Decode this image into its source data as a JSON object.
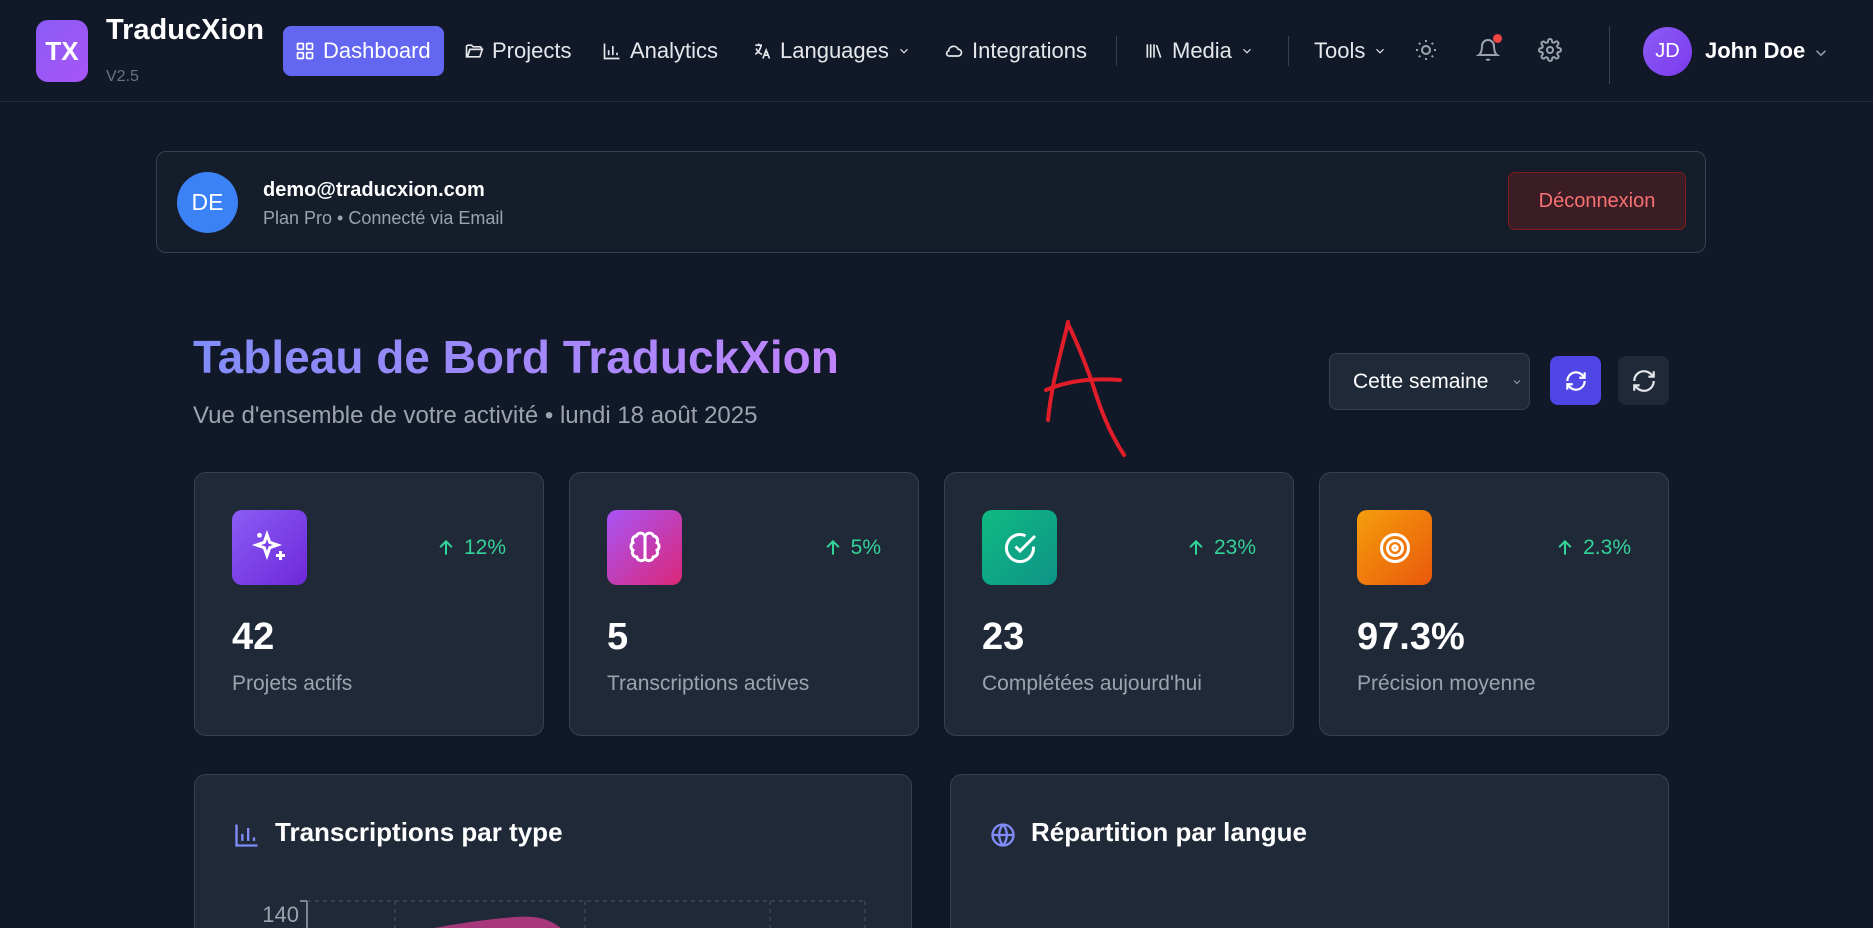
{
  "app": {
    "logo_text": "TX",
    "name": "TraducXion",
    "version": "V2.5"
  },
  "nav": {
    "dashboard": "Dashboard",
    "projects": "Projects",
    "analytics": "Analytics",
    "languages": "Languages",
    "integrations": "Integrations",
    "media": "Media",
    "tools": "Tools",
    "active_color": "#6366f1"
  },
  "user": {
    "initials": "JD",
    "name": "John Doe"
  },
  "account": {
    "initials": "DE",
    "email": "demo@traducxion.com",
    "plan": "Plan Pro • Connecté via Email",
    "logout": "Déconnexion"
  },
  "header": {
    "title": "Tableau de Bord TraduckXion",
    "subtitle": "Vue d'ensemble de votre activité • lundi 18 août 2025",
    "annotation": "A",
    "period": "Cette semaine"
  },
  "stats": [
    {
      "icon": "sparkles-icon",
      "color": "#8b5cf6",
      "trend": "12%",
      "value": "42",
      "label": "Projets actifs"
    },
    {
      "icon": "brain-icon",
      "color": "#c026d3",
      "trend": "5%",
      "value": "5",
      "label": "Transcriptions actives"
    },
    {
      "icon": "check-circle-icon",
      "color": "#10b981",
      "trend": "23%",
      "value": "23",
      "label": "Complétées aujourd'hui"
    },
    {
      "icon": "target-icon",
      "color": "#f97316",
      "trend": "2.3%",
      "value": "97.3%",
      "label": "Précision moyenne"
    }
  ],
  "panels": {
    "transcriptions_title": "Transcriptions par type",
    "languages_title": "Répartition par langue"
  },
  "chart_data": {
    "type": "area",
    "title": "Transcriptions par type",
    "y_tick_labels": [
      "140"
    ],
    "ylim": [
      0,
      140
    ],
    "grid": true
  }
}
